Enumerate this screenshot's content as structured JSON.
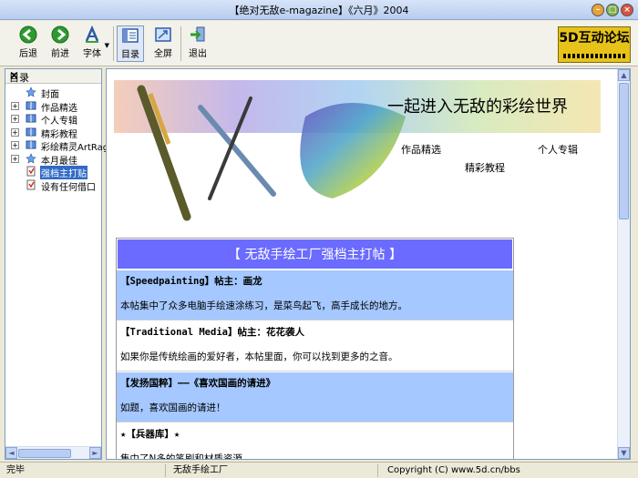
{
  "window": {
    "title": "【绝对无敌e-magazine】《六月》2004",
    "minimize": "–",
    "maximize": "□",
    "close": "×"
  },
  "toolbar": {
    "back": "后退",
    "forward": "前进",
    "font": "字体",
    "toc": "目录",
    "fullscreen": "全屏",
    "exit": "退出"
  },
  "logo": {
    "text": "5D互动论坛"
  },
  "sidebar": {
    "title": "目录",
    "close": "×",
    "items": [
      {
        "label": "封面",
        "expandable": false,
        "icon": "star-page-icon"
      },
      {
        "label": "作品精选",
        "expandable": true,
        "icon": "book-icon"
      },
      {
        "label": "个人专辑",
        "expandable": true,
        "icon": "book-icon"
      },
      {
        "label": "精彩教程",
        "expandable": true,
        "icon": "book-icon"
      },
      {
        "label": "彩绘精灵ArtRage",
        "expandable": true,
        "icon": "book-icon"
      },
      {
        "label": "本月最佳",
        "expandable": true,
        "icon": "star-page-icon"
      },
      {
        "label": "强档主打贴",
        "expandable": false,
        "icon": "doc-icon",
        "selected": true
      },
      {
        "label": "设有任何借口",
        "expandable": false,
        "icon": "doc-icon"
      }
    ]
  },
  "banner": {
    "slogan": "一起进入无敌的彩绘世界",
    "links": [
      "作品精选",
      "精彩教程",
      "个人专辑"
    ]
  },
  "posts": {
    "header": "【 无敌手绘工厂强档主打帖 】",
    "items": [
      {
        "title": "【Speedpainting】帖主：画龙",
        "body": "本帖集中了众多电脑手绘速涂练习，是菜鸟起飞，高手成长的地方。",
        "style": "blue"
      },
      {
        "title": "【Traditional Media】帖主：花花袭人",
        "body": "如果你是传统绘画的爱好者，本帖里面，你可以找到更多的之音。",
        "style": "white"
      },
      {
        "title": "【发扬国粹】——《喜欢国画的请进》",
        "body": "如题，喜欢国画的请进！",
        "style": "blue"
      },
      {
        "title": "★【兵器库】★",
        "body": "集中了N多的笔刷和材质资源。",
        "style": "white"
      }
    ]
  },
  "statusbar": {
    "status": "完毕",
    "section": "无敌手绘工厂",
    "copyright": "Copyright (C) www.5d.cn/bbs"
  }
}
